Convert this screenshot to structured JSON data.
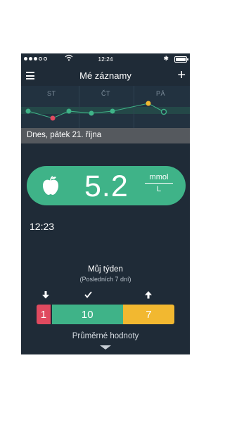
{
  "status_bar": {
    "time": "12:24",
    "signal_bars": 3,
    "signal_total": 5
  },
  "nav": {
    "title": "Mé záznamy",
    "menu_icon": "hamburger-menu-icon",
    "add_icon": "plus-icon"
  },
  "week_chart": {
    "days": [
      "ST",
      "ČT",
      "PÁ"
    ],
    "points": [
      {
        "color": "#3fb388"
      },
      {
        "color": "#e04a5f"
      },
      {
        "color": "#3fb388"
      },
      {
        "color": "#3fb388"
      },
      {
        "color": "#3fb388"
      },
      {
        "color": "#f2b830"
      },
      {
        "color": "#3fb388",
        "hollow": true
      }
    ],
    "band_color": "#27574f"
  },
  "date_label": "Dnes, pátek 21. října",
  "reading": {
    "value": "5.2",
    "unit_top": "mmol",
    "unit_bottom": "L",
    "icon": "apple-icon",
    "color": "#3fb388"
  },
  "reading_time": "12:23",
  "week_summary": {
    "title": "Můj týden",
    "subtitle": "(Posledních 7 dní)",
    "low_count": "1",
    "in_range_count": "10",
    "high_count": "7",
    "colors": {
      "low": "#e04a5f",
      "in_range": "#3fb388",
      "high": "#f2b830"
    }
  },
  "averages_label": "Průměrné hodnoty"
}
